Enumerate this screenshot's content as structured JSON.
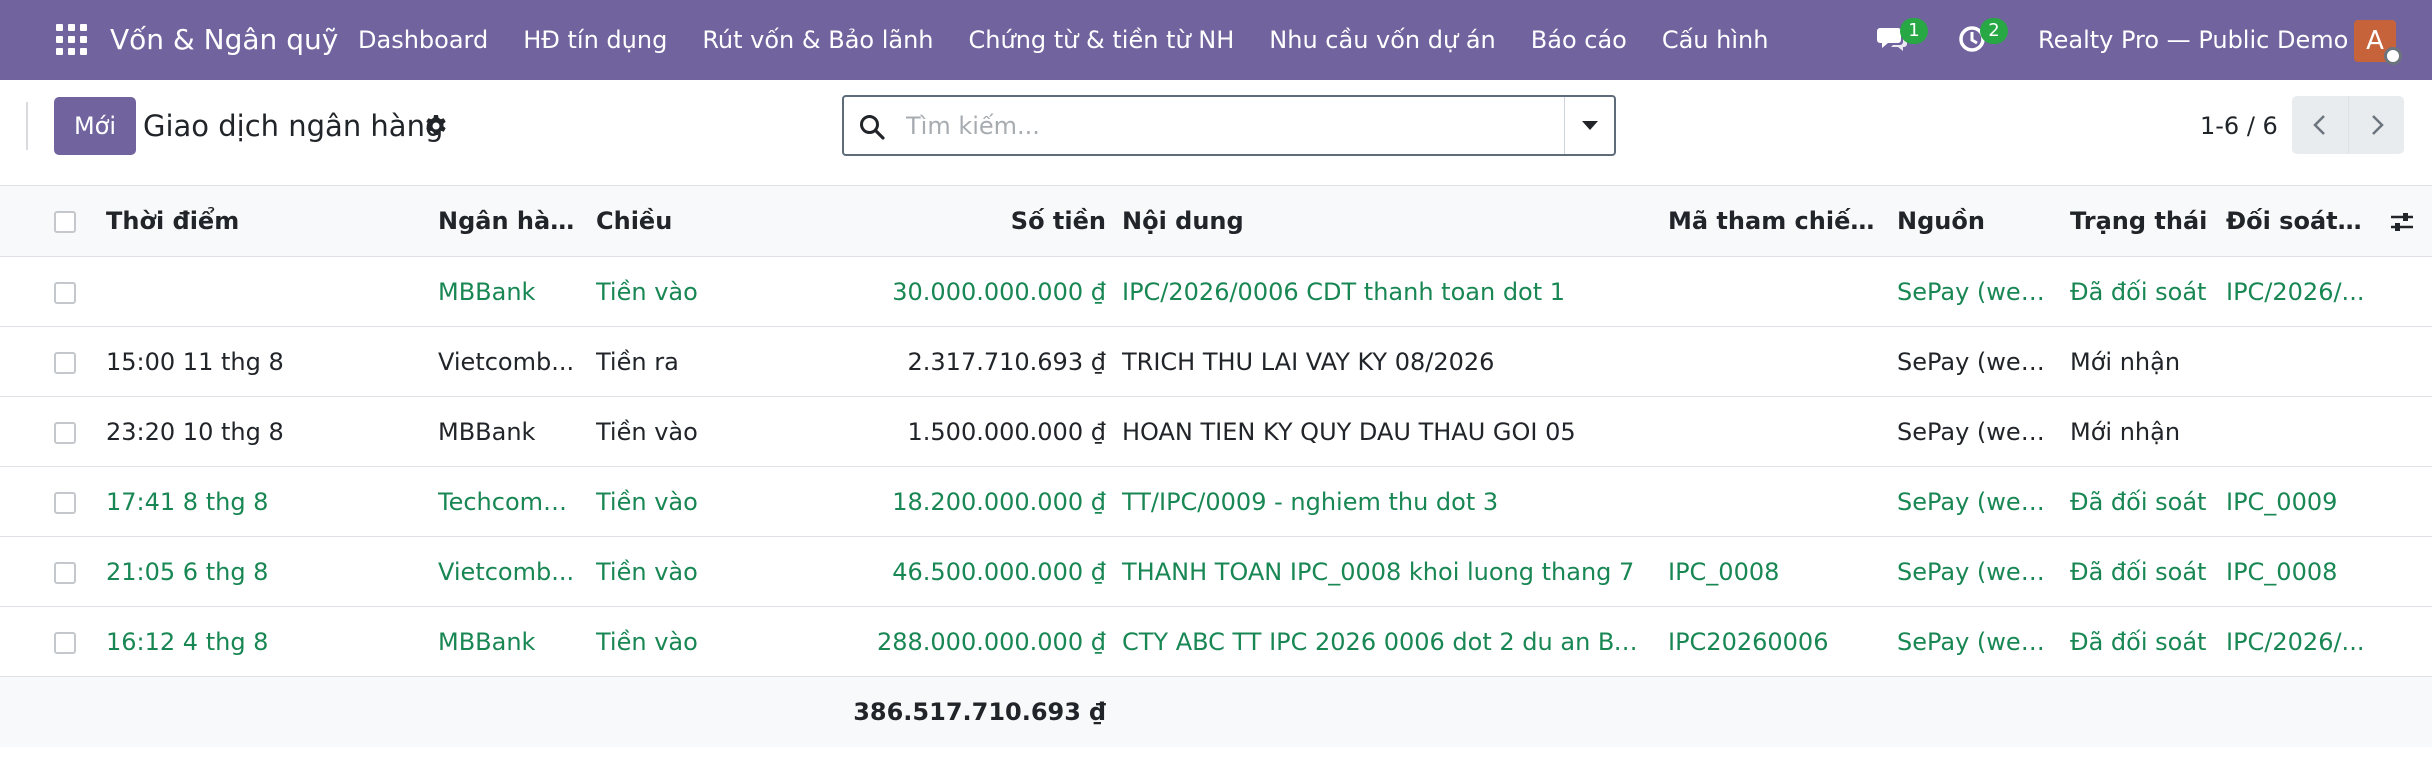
{
  "navbar": {
    "app_title": "Vốn & Ngân quỹ",
    "menu": [
      "Dashboard",
      "HĐ tín dụng",
      "Rút vốn & Bảo lãnh",
      "Chứng từ & tiền từ NH",
      "Nhu cầu vốn dự án",
      "Báo cáo",
      "Cấu hình"
    ],
    "messages_badge": "1",
    "activities_badge": "2",
    "company": "Realty Pro — Public Demo",
    "avatar_initial": "A",
    "color": "#71639e",
    "badge_color": "#28a745"
  },
  "control": {
    "new_label": "Mới",
    "page_title": "Giao dịch ngân hàng",
    "search_placeholder": "Tìm kiếm...",
    "pager": "1-6 / 6"
  },
  "table": {
    "columns": {
      "time": "Thời điểm",
      "bank": "Ngân hàng",
      "direction": "Chiều",
      "amount": "Số tiền",
      "content": "Nội dung",
      "reference": "Mã tham chiếu (...",
      "source": "Nguồn",
      "state": "Trạng thái",
      "reconcile": "Đối soát v..."
    },
    "rows": [
      {
        "time": "",
        "bank": "MBBank",
        "direction": "Tiền vào",
        "amount": "30.000.000.000 ₫",
        "content": "IPC/2026/0006 CDT thanh toan dot 1",
        "reference": "",
        "source": "SePay (web...",
        "state": "Đã đối soát",
        "reconcile": "IPC/2026/...",
        "status": "success"
      },
      {
        "time": "15:00 11 thg 8",
        "bank": "Vietcomb...",
        "direction": "Tiền ra",
        "amount": "2.317.710.693 ₫",
        "content": "TRICH THU LAI VAY KY 08/2026",
        "reference": "",
        "source": "SePay (web...",
        "state": "Mới nhận",
        "reconcile": "",
        "status": "normal"
      },
      {
        "time": "23:20 10 thg 8",
        "bank": "MBBank",
        "direction": "Tiền vào",
        "amount": "1.500.000.000 ₫",
        "content": "HOAN TIEN KY QUY DAU THAU GOI 05",
        "reference": "",
        "source": "SePay (web...",
        "state": "Mới nhận",
        "reconcile": "",
        "status": "normal"
      },
      {
        "time": "17:41 8 thg 8",
        "bank": "Techcomb...",
        "direction": "Tiền vào",
        "amount": "18.200.000.000 ₫",
        "content": "TT/IPC/0009 - nghiem thu dot 3",
        "reference": "",
        "source": "SePay (web...",
        "state": "Đã đối soát",
        "reconcile": "IPC_0009",
        "status": "success"
      },
      {
        "time": "21:05 6 thg 8",
        "bank": "Vietcomb...",
        "direction": "Tiền vào",
        "amount": "46.500.000.000 ₫",
        "content": "THANH TOAN IPC_0008 khoi luong thang 7",
        "reference": "IPC_0008",
        "source": "SePay (web...",
        "state": "Đã đối soát",
        "reconcile": "IPC_0008",
        "status": "success"
      },
      {
        "time": "16:12 4 thg 8",
        "bank": "MBBank",
        "direction": "Tiền vào",
        "amount": "288.000.000.000 ₫",
        "content": "CTY ABC TT IPC 2026 0006 dot 2 du an BV...",
        "reference": "IPC20260006",
        "source": "SePay (web...",
        "state": "Đã đối soát",
        "reconcile": "IPC/2026/...",
        "status": "success"
      }
    ],
    "total": "386.517.710.693 ₫",
    "success_color": "#198754"
  }
}
